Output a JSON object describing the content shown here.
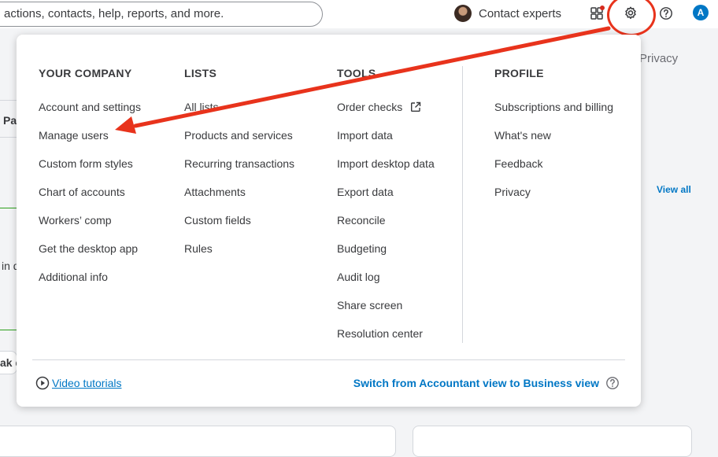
{
  "topbar": {
    "search_value": "actions, contacts, help, reports, and more.",
    "contact_label": "Contact experts",
    "user_initial": "A"
  },
  "background": {
    "privacy": "Privacy",
    "view_all": "View all",
    "frag_pa": "Pa",
    "frag_in": "in d",
    "frag_ak": "ak d"
  },
  "menu": {
    "your_company": {
      "heading": "YOUR COMPANY",
      "items": [
        "Account and settings",
        "Manage users",
        "Custom form styles",
        "Chart of accounts",
        "Workers’ comp",
        "Get the desktop app",
        "Additional info"
      ]
    },
    "lists": {
      "heading": "LISTS",
      "items": [
        "All lists",
        "Products and services",
        "Recurring transactions",
        "Attachments",
        "Custom fields",
        "Rules"
      ]
    },
    "tools": {
      "heading": "TOOLS",
      "items": [
        "Order checks",
        "Import data",
        "Import desktop data",
        "Export data",
        "Reconcile",
        "Budgeting",
        "Audit log",
        "Share screen",
        "Resolution center"
      ]
    },
    "profile": {
      "heading": "PROFILE",
      "items": [
        "Subscriptions and billing",
        "What's new",
        "Feedback",
        "Privacy"
      ]
    }
  },
  "footer": {
    "video_tutorials": "Video tutorials",
    "switch_view": "Switch from Accountant view to Business view"
  },
  "colors": {
    "link_blue": "#0077c5",
    "annotation_red": "#e8331c",
    "text_primary": "#393a3d"
  },
  "icons": {
    "gear": "gear-icon",
    "help": "help-icon",
    "apps": "apps-icon",
    "external_link": "external-link-icon",
    "play": "play-circle-icon"
  }
}
